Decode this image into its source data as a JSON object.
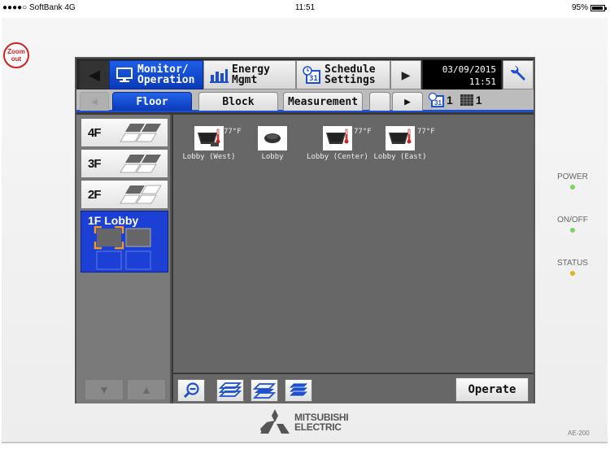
{
  "status_bar": {
    "carrier": "●●●●○ SoftBank  4G",
    "time": "11:51",
    "battery": "95%",
    "battery_level": 0.95
  },
  "zoom_out_label_line1": "Zoom",
  "zoom_out_label_line2": "out",
  "top_nav": {
    "tabs": [
      {
        "line1": "Monitor/",
        "line2": "Operation",
        "icon": "monitor-icon",
        "active": true
      },
      {
        "line1": "Energy",
        "line2": "Mgmt",
        "icon": "bar-chart-icon",
        "active": false
      },
      {
        "line1": "Schedule",
        "line2": "Settings",
        "icon": "calendar-clock-icon",
        "active": false
      }
    ],
    "date": "03/09/2015",
    "time": "11:51"
  },
  "sub_nav": {
    "tabs": [
      {
        "label": "Floor",
        "active": true
      },
      {
        "label": "Block",
        "active": false
      },
      {
        "label": "Measurement",
        "active": false
      },
      {
        "label": "",
        "active": false
      }
    ],
    "schedule_count": "1",
    "grid_count": "1"
  },
  "floors": [
    {
      "label": "4F",
      "active": false
    },
    {
      "label": "3F",
      "active": false
    },
    {
      "label": "2F",
      "active": false
    },
    {
      "label": "1F Lobby",
      "active": true
    }
  ],
  "units": [
    {
      "name": "Lobby (West)",
      "temp": "77°F",
      "type": "ceiling-cassette-icon"
    },
    {
      "name": "Lobby",
      "temp": "",
      "type": "round-unit-icon"
    },
    {
      "name": "Lobby (Center)",
      "temp": "77°F",
      "type": "ceiling-cassette-icon"
    },
    {
      "name": "Lobby (East)",
      "temp": "77°F",
      "type": "ceiling-cassette-icon"
    }
  ],
  "bottom_toolbar": {
    "operate_label": "Operate"
  },
  "indicators": [
    {
      "label": "POWER",
      "color": "#7ccf6a"
    },
    {
      "label": "ON/OFF",
      "color": "#7ccf6a"
    },
    {
      "label": "STATUS",
      "color": "#e8b020"
    }
  ],
  "brand": {
    "line1": "MITSUBISHI",
    "line2": "ELECTRIC",
    "model": "AE-200"
  }
}
